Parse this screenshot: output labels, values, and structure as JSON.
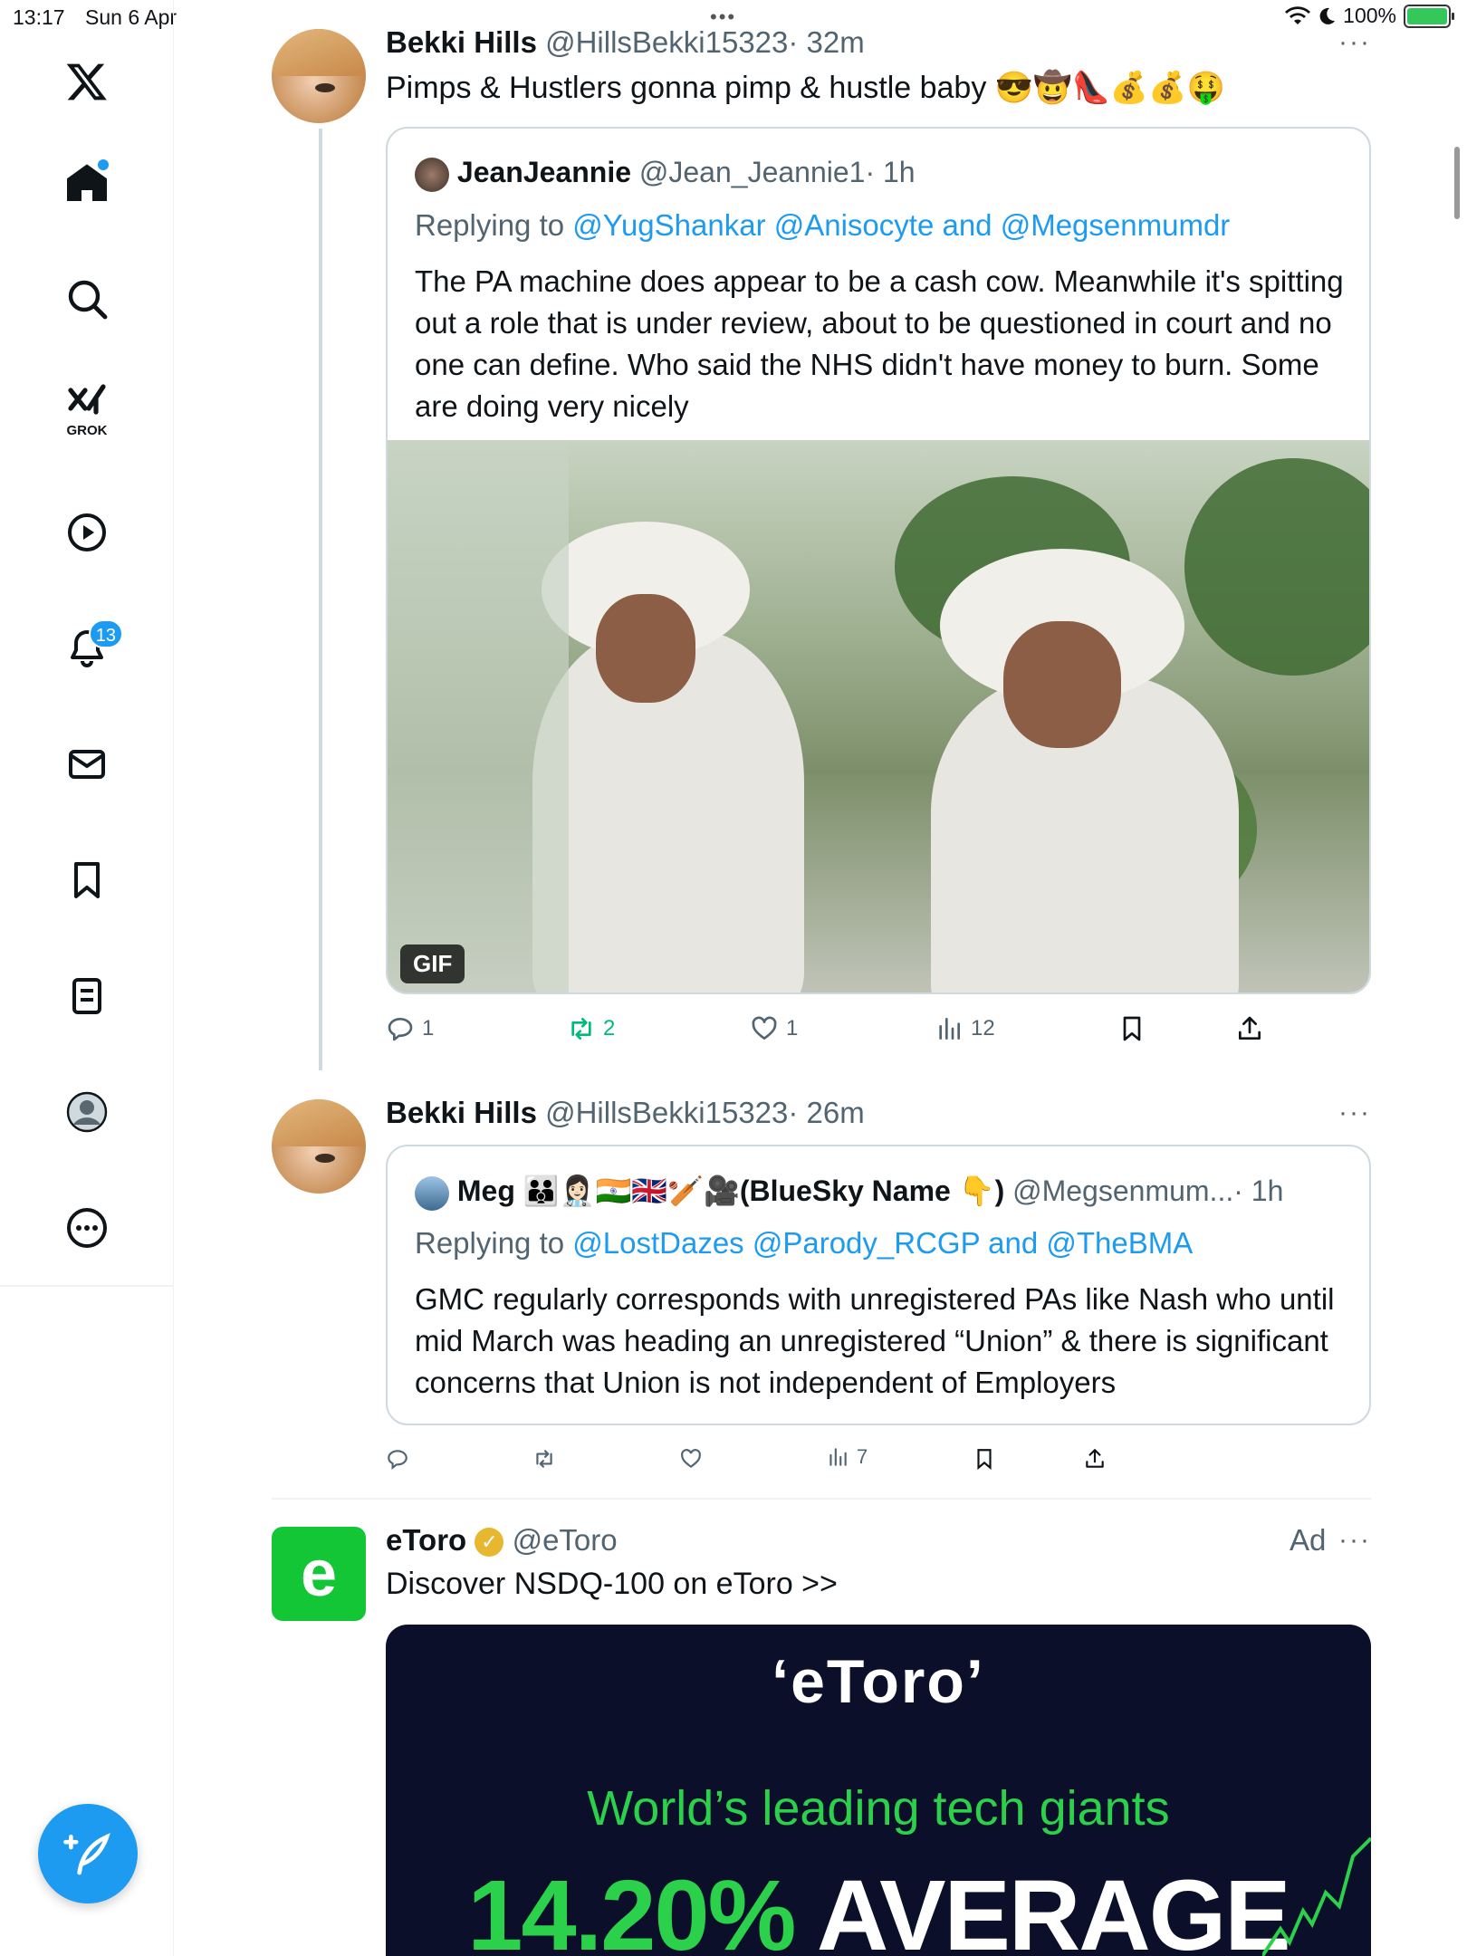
{
  "status_bar": {
    "time": "13:17",
    "date": "Sun 6 Apr",
    "battery": "100%",
    "battery_level": 1.0
  },
  "sidebar": {
    "items": [
      {
        "icon": "x-logo-icon"
      },
      {
        "icon": "home-icon",
        "has_dot": true
      },
      {
        "icon": "search-icon"
      },
      {
        "icon": "grok-icon",
        "label": "GROK"
      },
      {
        "icon": "video-icon"
      },
      {
        "icon": "notifications-icon",
        "badge": "13"
      },
      {
        "icon": "messages-icon"
      },
      {
        "icon": "bookmarks-icon"
      },
      {
        "icon": "lists-icon"
      },
      {
        "icon": "profile-icon"
      },
      {
        "icon": "more-icon"
      }
    ],
    "compose_icon": "compose-icon",
    "accent": "#1d9bf0"
  },
  "posts": [
    {
      "author_name": "Bekki Hills",
      "author_handle": "@HillsBekki15323",
      "time": "· 32m",
      "text": "Pimps & Hustlers gonna pimp & hustle baby 😎🤠👠💰💰🤑",
      "quote": {
        "author_name": "JeanJeannie",
        "author_handle": "@Jean_Jeannie1",
        "time": "· 1h",
        "replying_prefix": "Replying to ",
        "replying_to": "@YugShankar @Anisocyte and @Megsenmumdr",
        "text": "The PA machine does appear to be a cash cow. Meanwhile it's spitting out a role that is under review, about to be questioned in court and no one can define. Who said the NHS didn't have money to burn. Some are doing very nicely",
        "media_badge": "GIF"
      },
      "stats": {
        "replies": "1",
        "reposts": "2",
        "likes": "1",
        "views": "12"
      }
    },
    {
      "author_name": "Bekki Hills",
      "author_handle": "@HillsBekki15323",
      "time": "· 26m",
      "quote": {
        "author_name": "Meg 👪👩🏻‍⚕️🇮🇳🇬🇧🏏🎥(BlueSky Name 👇)",
        "author_handle": "@Megsenmum...",
        "time": "· 1h",
        "replying_prefix": "Replying to ",
        "replying_to": "@LostDazes @Parody_RCGP and @TheBMA",
        "text": "GMC regularly corresponds with unregistered PAs like Nash who until mid March was heading an unregistered “Union” & there is significant concerns that Union is not independent of Employers"
      },
      "stats": {
        "replies": "",
        "reposts": "",
        "likes": "",
        "views": "7"
      }
    }
  ],
  "ad": {
    "author_name": "eToro",
    "author_handle": "@eToro",
    "ad_label": "Ad",
    "text": "Discover NSDQ-100 on eToro >>",
    "logo_letter": "e",
    "card_brand": "‘eToro’",
    "card_headline": "World’s leading tech giants",
    "card_pct": "14.20%",
    "card_word": "AVERAGE",
    "brand_color": "#13c636"
  },
  "more_label": "···"
}
